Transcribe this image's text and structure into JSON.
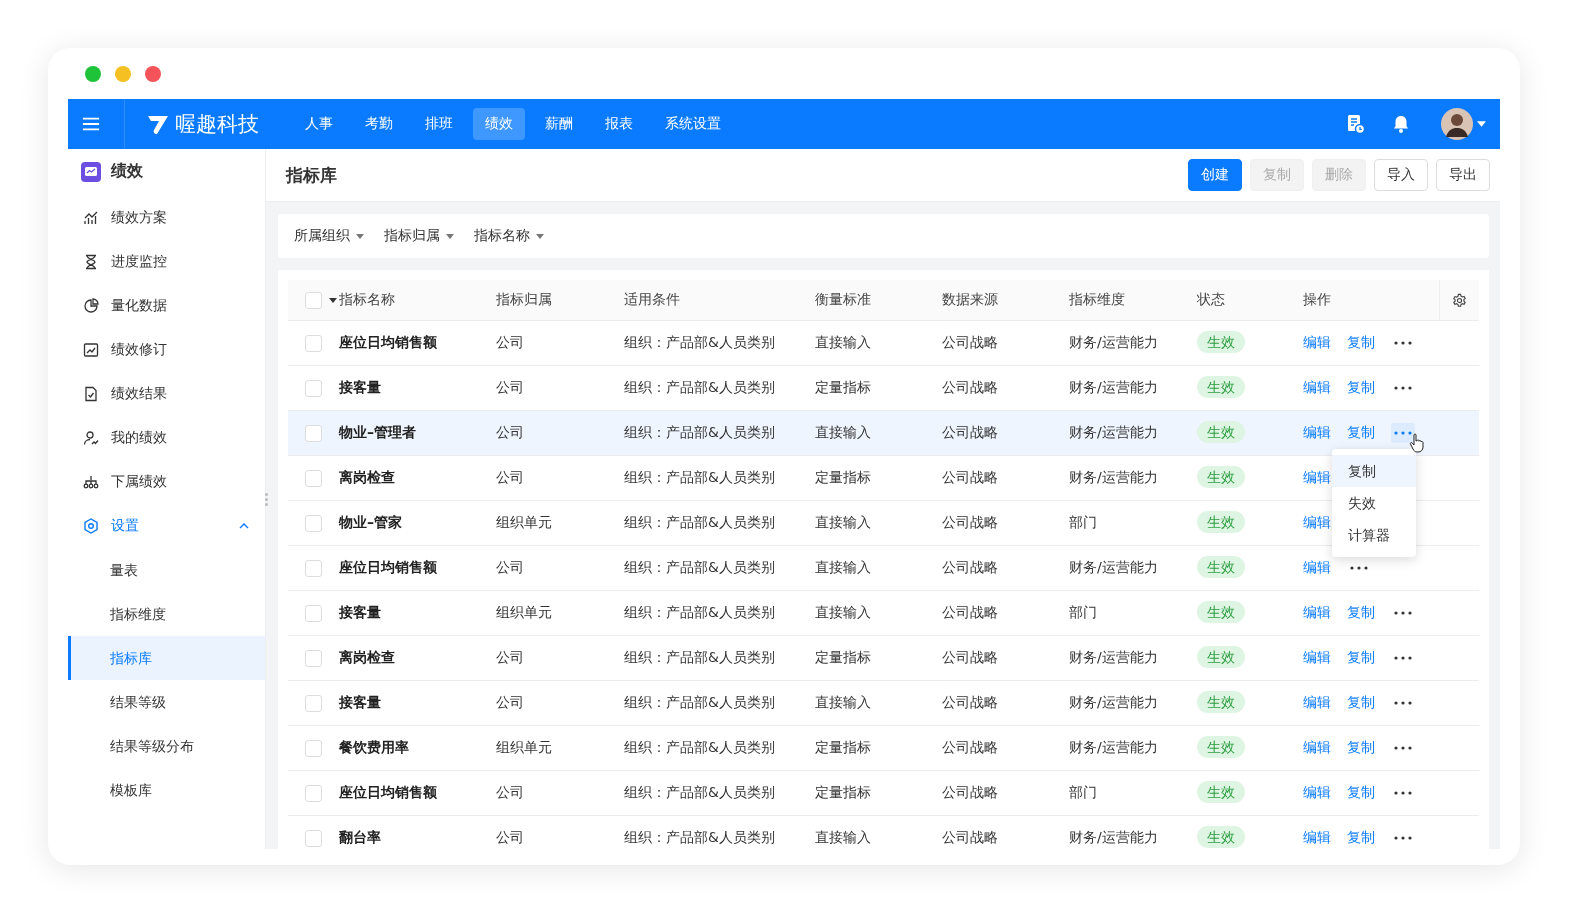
{
  "nav": {
    "logo": "喔趣科技",
    "items": [
      {
        "label": "人事",
        "selected": false
      },
      {
        "label": "考勤",
        "selected": false
      },
      {
        "label": "排班",
        "selected": false
      },
      {
        "label": "绩效",
        "selected": true
      },
      {
        "label": "薪酬",
        "selected": false
      },
      {
        "label": "报表",
        "selected": false
      },
      {
        "label": "系统设置",
        "selected": false
      }
    ]
  },
  "sidebar": {
    "title": "绩效",
    "items": [
      {
        "label": "绩效方案"
      },
      {
        "label": "进度监控"
      },
      {
        "label": "量化数据"
      },
      {
        "label": "绩效修订"
      },
      {
        "label": "绩效结果"
      },
      {
        "label": "我的绩效"
      },
      {
        "label": "下属绩效"
      }
    ],
    "group": {
      "label": "设置",
      "expanded": true,
      "children": [
        {
          "label": "量表",
          "selected": false
        },
        {
          "label": "指标维度",
          "selected": false
        },
        {
          "label": "指标库",
          "selected": true
        },
        {
          "label": "结果等级",
          "selected": false
        },
        {
          "label": "结果等级分布",
          "selected": false
        },
        {
          "label": "模板库",
          "selected": false
        }
      ]
    }
  },
  "page": {
    "title": "指标库",
    "buttons": [
      {
        "label": "创建",
        "kind": "primary"
      },
      {
        "label": "复制",
        "kind": "disabled"
      },
      {
        "label": "删除",
        "kind": "disabled"
      },
      {
        "label": "导入",
        "kind": "default"
      },
      {
        "label": "导出",
        "kind": "default"
      }
    ]
  },
  "filters": [
    "所属组织",
    "指标归属",
    "指标名称"
  ],
  "table": {
    "all_checked": false,
    "columns": [
      "指标名称",
      "指标归属",
      "适用条件",
      "衡量标准",
      "数据来源",
      "指标维度",
      "状态",
      "操作"
    ],
    "rows": [
      {
        "name": "座位日均销售额",
        "owner": "公司",
        "condition": "组织：产品部&人员类别",
        "measure": "直接输入",
        "source": "公司战略",
        "dimension": "财务/运营能力",
        "status": "生效",
        "selected": false,
        "actions": [
          "编辑",
          "复制"
        ],
        "more": true
      },
      {
        "name": "接客量",
        "owner": "公司",
        "condition": "组织：产品部&人员类别",
        "measure": "定量指标",
        "source": "公司战略",
        "dimension": "财务/运营能力",
        "status": "生效",
        "selected": false,
        "actions": [
          "编辑",
          "复制"
        ],
        "more": true
      },
      {
        "name": "物业–管理者",
        "owner": "公司",
        "condition": "组织：产品部&人员类别",
        "measure": "直接输入",
        "source": "公司战略",
        "dimension": "财务/运营能力",
        "status": "生效",
        "selected": true,
        "actions": [
          "编辑",
          "复制"
        ],
        "more": true
      },
      {
        "name": "离岗检查",
        "owner": "公司",
        "condition": "组织：产品部&人员类别",
        "measure": "定量指标",
        "source": "公司战略",
        "dimension": "财务/运营能力",
        "status": "生效",
        "selected": false,
        "actions": [
          "编辑"
        ],
        "more": false
      },
      {
        "name": "物业–管家",
        "owner": "组织单元",
        "condition": "组织：产品部&人员类别",
        "measure": "直接输入",
        "source": "公司战略",
        "dimension": "部门",
        "status": "生效",
        "selected": false,
        "actions": [
          "编辑"
        ],
        "more": false
      },
      {
        "name": "座位日均销售额",
        "owner": "公司",
        "condition": "组织：产品部&人员类别",
        "measure": "直接输入",
        "source": "公司战略",
        "dimension": "财务/运营能力",
        "status": "生效",
        "selected": false,
        "actions": [
          "编辑"
        ],
        "more": true
      },
      {
        "name": "接客量",
        "owner": "组织单元",
        "condition": "组织：产品部&人员类别",
        "measure": "直接输入",
        "source": "公司战略",
        "dimension": "部门",
        "status": "生效",
        "selected": false,
        "actions": [
          "编辑",
          "复制"
        ],
        "more": true
      },
      {
        "name": "离岗检查",
        "owner": "公司",
        "condition": "组织：产品部&人员类别",
        "measure": "定量指标",
        "source": "公司战略",
        "dimension": "财务/运营能力",
        "status": "生效",
        "selected": false,
        "actions": [
          "编辑",
          "复制"
        ],
        "more": true
      },
      {
        "name": "接客量",
        "owner": "公司",
        "condition": "组织：产品部&人员类别",
        "measure": "直接输入",
        "source": "公司战略",
        "dimension": "财务/运营能力",
        "status": "生效",
        "selected": false,
        "actions": [
          "编辑",
          "复制"
        ],
        "more": true
      },
      {
        "name": "餐饮费用率",
        "owner": "组织单元",
        "condition": "组织：产品部&人员类别",
        "measure": "定量指标",
        "source": "公司战略",
        "dimension": "财务/运营能力",
        "status": "生效",
        "selected": false,
        "actions": [
          "编辑",
          "复制"
        ],
        "more": true
      },
      {
        "name": "座位日均销售额",
        "owner": "公司",
        "condition": "组织：产品部&人员类别",
        "measure": "定量指标",
        "source": "公司战略",
        "dimension": "部门",
        "status": "生效",
        "selected": false,
        "actions": [
          "编辑",
          "复制"
        ],
        "more": true
      },
      {
        "name": "翻台率",
        "owner": "公司",
        "condition": "组织：产品部&人员类别",
        "measure": "直接输入",
        "source": "公司战略",
        "dimension": "财务/运营能力",
        "status": "生效",
        "selected": false,
        "actions": [
          "编辑",
          "复制"
        ],
        "more": true
      }
    ]
  },
  "menu": {
    "items": [
      {
        "label": "复制",
        "selected": true
      },
      {
        "label": "失效",
        "selected": false
      },
      {
        "label": "计算器",
        "selected": false
      }
    ]
  }
}
